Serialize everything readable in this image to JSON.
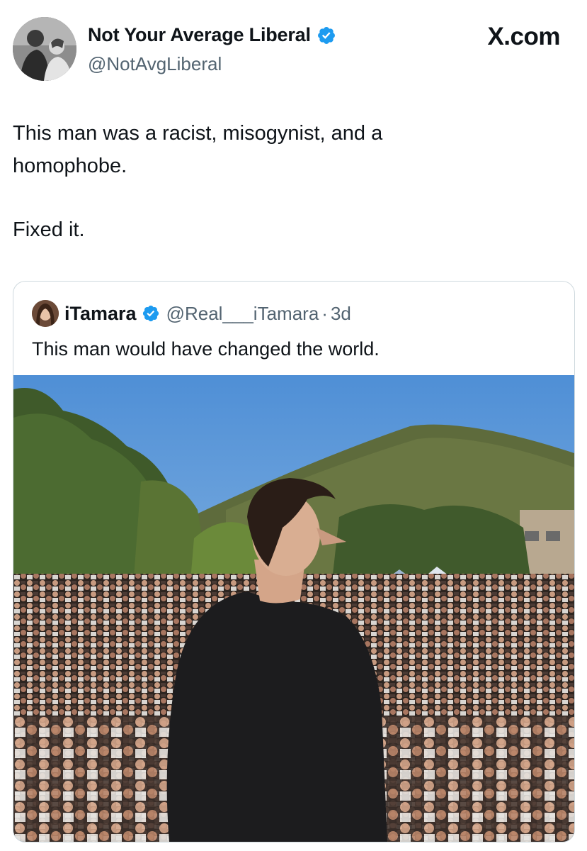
{
  "post": {
    "author": {
      "display_name": "Not Your Average Liberal",
      "handle": "@NotAvgLiberal",
      "verified": true
    },
    "site_label": "X.com",
    "text_lines": [
      "This man was a racist, misogynist, and a",
      "homophobe.",
      "Fixed it."
    ]
  },
  "quoted_post": {
    "author": {
      "display_name": "iTamara",
      "handle": "@Real___iTamara",
      "verified": true
    },
    "separator": "·",
    "time": "3d",
    "text": "This man would have changed the world."
  },
  "colors": {
    "verified_badge": "#1d9bf0",
    "secondary_text": "#536471",
    "border": "#cfd9de"
  },
  "icons": {
    "verified": "verified-badge-icon"
  }
}
